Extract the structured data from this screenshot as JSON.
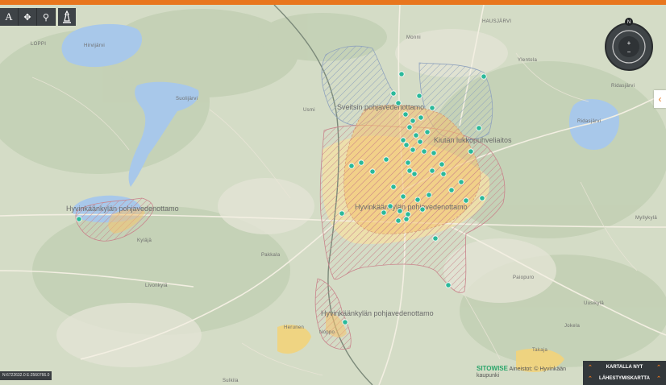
{
  "toolbar": {
    "text_tool": "A",
    "pan_icon": "move-icon",
    "marker_icon": "location-pin-icon",
    "measure_icon": "tower-icon"
  },
  "nav": {
    "compass_north": "N",
    "zoom_in": "+",
    "zoom_out": "−"
  },
  "zones": {
    "sveitsi": "Sveitsin pohjavedenottamo",
    "kiutakorpi": "Kiutan lukkopuhveliaitos",
    "hyvinkaa": "Hyvinkäänkylän pohjavedenottamo",
    "hyvinkaa_west": "Hyvinkäänkylän pohjavedenottamo",
    "hyvinkaa_south": "Hyvinkäänkylän pohjavedenottamo"
  },
  "places": {
    "loppi": "LOPPI",
    "hirvijarvi": "Hirvijärvi",
    "suolijarvi": "Suolijärvi",
    "usmi": "Usmi",
    "monni": "Monni",
    "hausjarvi": "HAUSJÄRVI",
    "ylentola": "Ylentola",
    "ridasjarvi": "Ridasjärvi",
    "ridasjarvi2": "Ridasjärvi",
    "myllykyla": "Myllykylä",
    "kylaja": "Kyläjä",
    "livonkyla": "Livonkylä",
    "pakkala": "Pakkala",
    "paiopuro": "Paiopuro",
    "uusikyla": "Uusikylä",
    "herunen": "Herunen",
    "noppo": "Noppo",
    "takaja": "Takaja",
    "jokela": "Jokela",
    "sulkava": "Sulkila"
  },
  "coordinates": "N:6722632.0 E:2560766.0",
  "attribution": {
    "brand": "SITOWISE",
    "text": "Aineistot: © Hyvinkään",
    "line2": "kaupunki"
  },
  "panel": {
    "map_now": "KARTALLA NYT",
    "nearby_map": "LÄHESTYMISKARTTA"
  },
  "sidetab": "‹",
  "colors": {
    "accent": "#e8761e",
    "zone_fill": "#f6c36e",
    "hatch": "#c9848c",
    "blue_hatch": "#8fa2bd",
    "marker": "#2bb99a"
  }
}
